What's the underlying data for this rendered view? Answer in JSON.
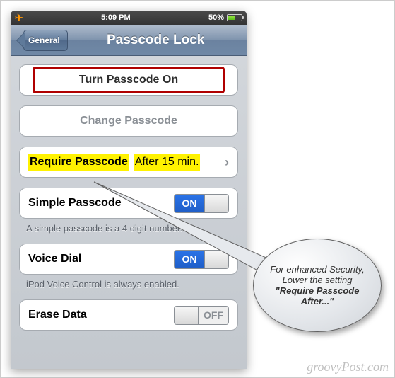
{
  "statusbar": {
    "time": "5:09 PM",
    "battery_pct": "50%"
  },
  "nav": {
    "back_label": "General",
    "title": "Passcode Lock"
  },
  "cells": {
    "turn_on": "Turn Passcode On",
    "change": "Change Passcode",
    "require_label": "Require Passcode",
    "require_value": "After 15 min.",
    "simple_label": "Simple Passcode",
    "simple_state": "ON",
    "simple_footer": "A simple passcode is a 4 digit number.",
    "voice_label": "Voice Dial",
    "voice_state": "ON",
    "voice_footer": "iPod Voice Control is always enabled.",
    "erase_label": "Erase Data",
    "erase_state": "OFF"
  },
  "callout": {
    "line1": "For enhanced Security, Lower the setting ",
    "bold": "\"Require Passcode After...\""
  },
  "watermark": "groovyPost.com"
}
